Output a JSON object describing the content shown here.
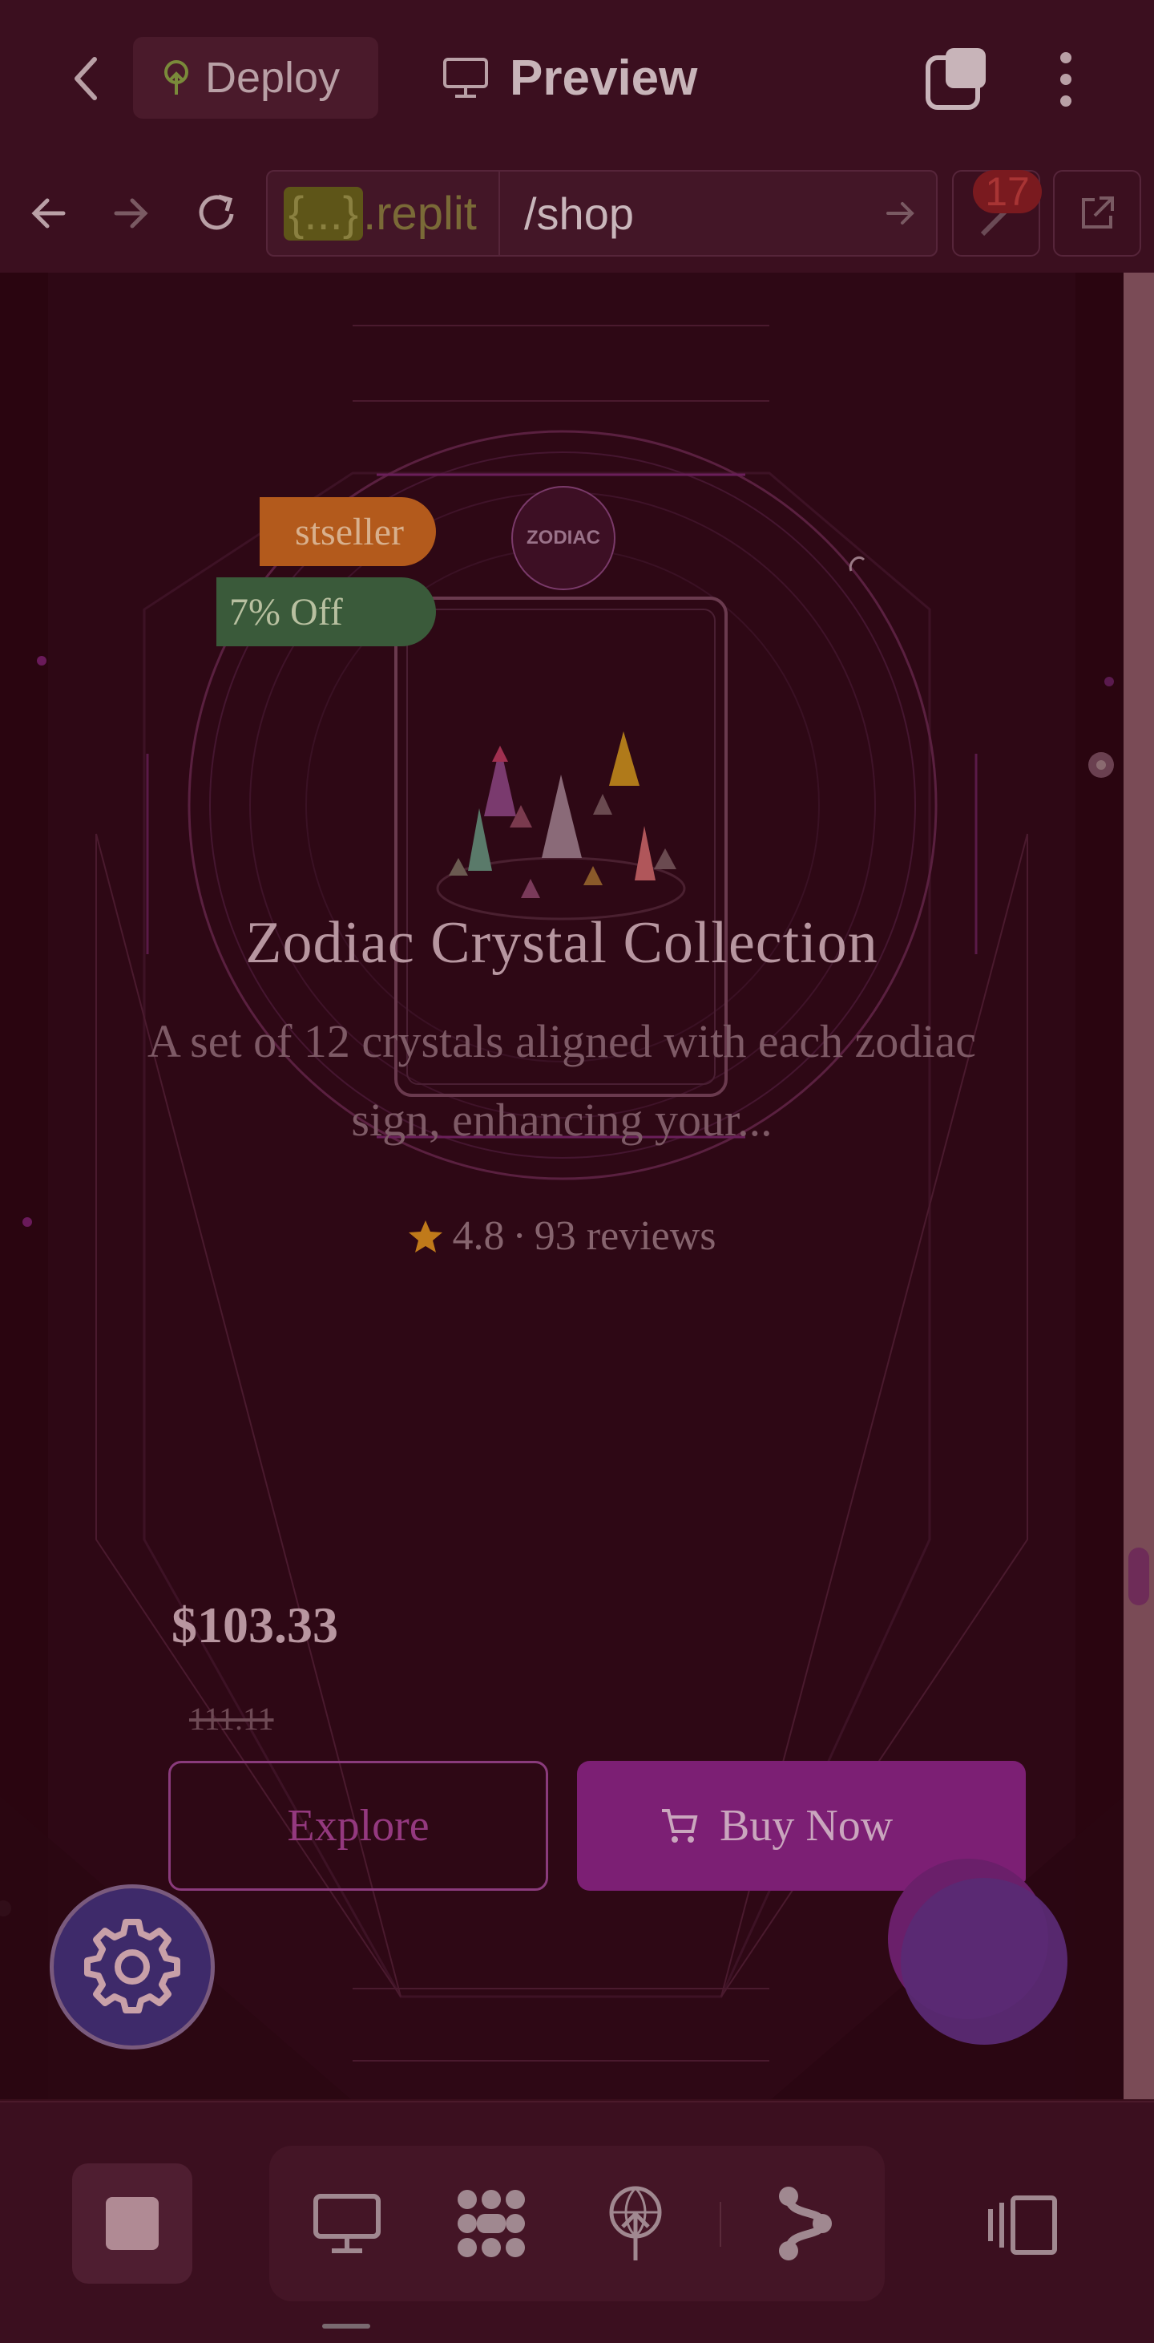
{
  "topbar": {
    "deploy_label": "Deploy",
    "preview_label": "Preview"
  },
  "addressbar": {
    "host_highlight": "{...}",
    "host_rest": ".replit",
    "path": "/shop",
    "badge_count": "17"
  },
  "product": {
    "bestseller_label": "stseller",
    "discount_label": "7% Off",
    "zodiac_badge": "ZODIAC",
    "title": "Zodiac Crystal Collection",
    "description": "A set of 12 crystals aligned with each zodiac sign, enhancing your...",
    "rating": "4.8",
    "rating_separator": "·",
    "reviews": "93 reviews",
    "price": "$103.33",
    "old_price": "111.11",
    "explore_label": "Explore",
    "buy_label": "Buy Now"
  },
  "colors": {
    "accent_purple": "#7c1f74",
    "bestseller_orange": "#b35a1c",
    "discount_green": "#3a5a3a",
    "star": "#c07a1a"
  }
}
